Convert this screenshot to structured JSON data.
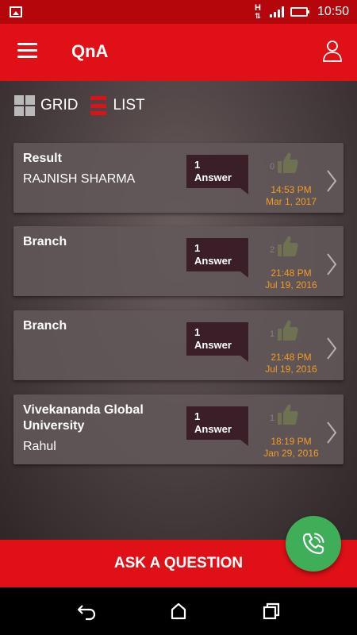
{
  "status_bar": {
    "time": "10:50",
    "network_label": "H"
  },
  "app_bar": {
    "title": "QnA",
    "menu_icon": "menu-icon",
    "profile_icon": "person-icon"
  },
  "view_toggle": {
    "grid_label": "GRID",
    "list_label": "LIST",
    "active": "list"
  },
  "questions": [
    {
      "title": "Result",
      "author": "RAJNISH SHARMA",
      "answers_count": "1",
      "answers_label": "Answer",
      "likes": "0",
      "time": "14:53 PM",
      "date": "Mar 1, 2017"
    },
    {
      "title": "Branch",
      "author": "",
      "answers_count": "1",
      "answers_label": "Answer",
      "likes": "2",
      "time": "21:48 PM",
      "date": "Jul 19, 2016"
    },
    {
      "title": "Branch",
      "author": "",
      "answers_count": "1",
      "answers_label": "Answer",
      "likes": "1",
      "time": "21:48 PM",
      "date": "Jul 19, 2016"
    },
    {
      "title": "Vivekananda Global University",
      "author": "Rahul",
      "answers_count": "1",
      "answers_label": "Answer",
      "likes": "1",
      "time": "18:19 PM",
      "date": "Jan 29, 2016"
    }
  ],
  "ask_button": {
    "label": "ASK A QUESTION"
  },
  "colors": {
    "primary": "#e01017",
    "status_bar": "#b5060b",
    "accent_time": "#f39a26",
    "fab": "#3fae59"
  }
}
